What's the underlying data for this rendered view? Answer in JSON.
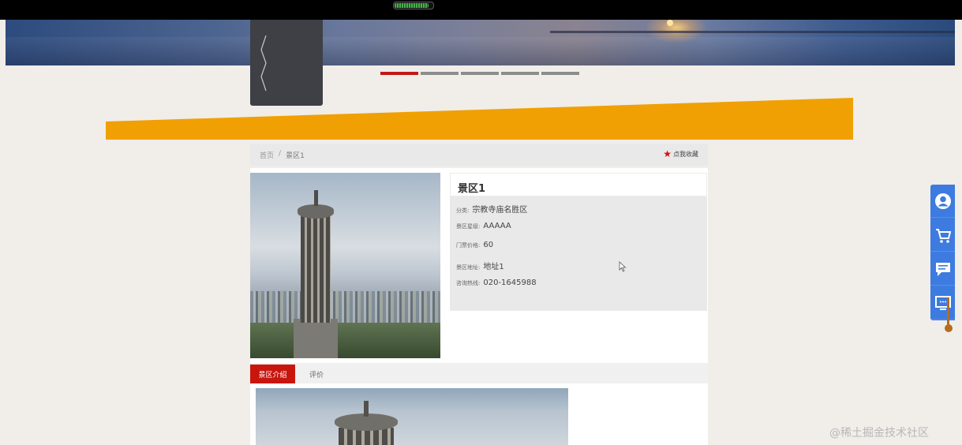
{
  "battery_level": 0.9,
  "carousel": {
    "slide_count": 5,
    "active_index": 0
  },
  "breadcrumb": {
    "home": "首页",
    "separator": "/",
    "current": "景区1"
  },
  "favorite": {
    "icon": "star-icon",
    "label": "点我收藏"
  },
  "scenic": {
    "title": "景区1",
    "fields": [
      {
        "label": "分类:",
        "value": "宗教寺庙名胜区"
      },
      {
        "label": "景区星级:",
        "value": "AAAAA"
      },
      {
        "label": "门票价格:",
        "value": "60"
      },
      {
        "label": "景区地址:",
        "value": "地址1"
      },
      {
        "label": "咨询热线:",
        "value": "020-1645988"
      }
    ]
  },
  "tabs": {
    "intro": "景区介绍",
    "review": "评价"
  },
  "side_nav": [
    {
      "icon": "user-icon"
    },
    {
      "icon": "cart-icon"
    },
    {
      "icon": "chat-icon"
    },
    {
      "icon": "monitor-icon"
    }
  ],
  "colors": {
    "accent_red": "#c8160f",
    "orange_band": "#f0a002",
    "side_nav_blue": "#3d7be0"
  },
  "watermark": "@稀土掘金技术社区"
}
